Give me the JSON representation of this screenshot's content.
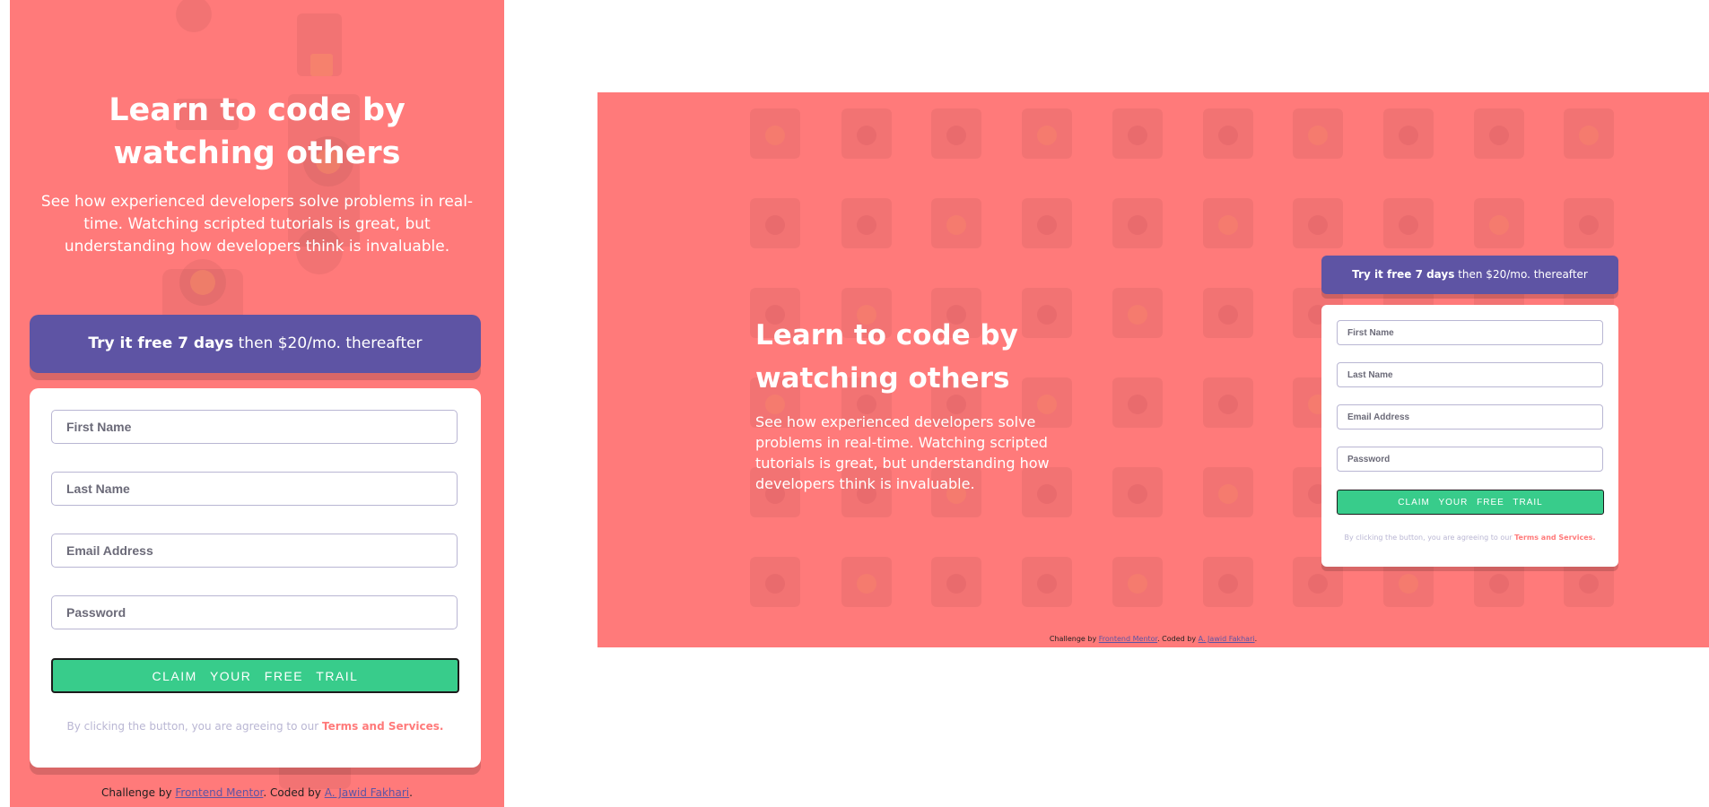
{
  "hero": {
    "title": "Learn to code by watching others",
    "description": "See how experienced developers solve problems in real-time. Watching scripted tutorials is great, but understanding how developers think is invaluable."
  },
  "promo": {
    "bold": "Try it free 7 days",
    "rest": " then $20/mo. thereafter"
  },
  "form": {
    "first_name_placeholder": "First Name",
    "last_name_placeholder": "Last Name",
    "email_placeholder": "Email Address",
    "password_placeholder": "Password",
    "submit_label": "CLAIM YOUR FREE TRAIL",
    "terms_prefix": "By clicking the button, you are agreeing to our ",
    "terms_link": "Terms and Services",
    "terms_suffix": "."
  },
  "attribution": {
    "prefix": "Challenge by ",
    "challenge_link": "Frontend Mentor",
    "middle": ". Coded by ",
    "author_link": "A. Jawid Fakhari",
    "suffix": "."
  },
  "colors": {
    "background_red": "#ff7a7a",
    "promo_purple": "#5e54a4",
    "cta_green": "#38cc8b",
    "field_border": "#b9b6d3"
  },
  "icons": [
    "atom-icon",
    "robot-icon",
    "gear-icon",
    "rocket-icon",
    "puzzle-icon",
    "browser-window-icon",
    "bar-chart-icon",
    "magnet-icon",
    "lifebuoy-icon",
    "calendar-icon",
    "lightbulb-icon",
    "toolbox-icon",
    "shopping-cart-icon",
    "headset-icon",
    "thumbs-up-icon",
    "key-icon"
  ]
}
